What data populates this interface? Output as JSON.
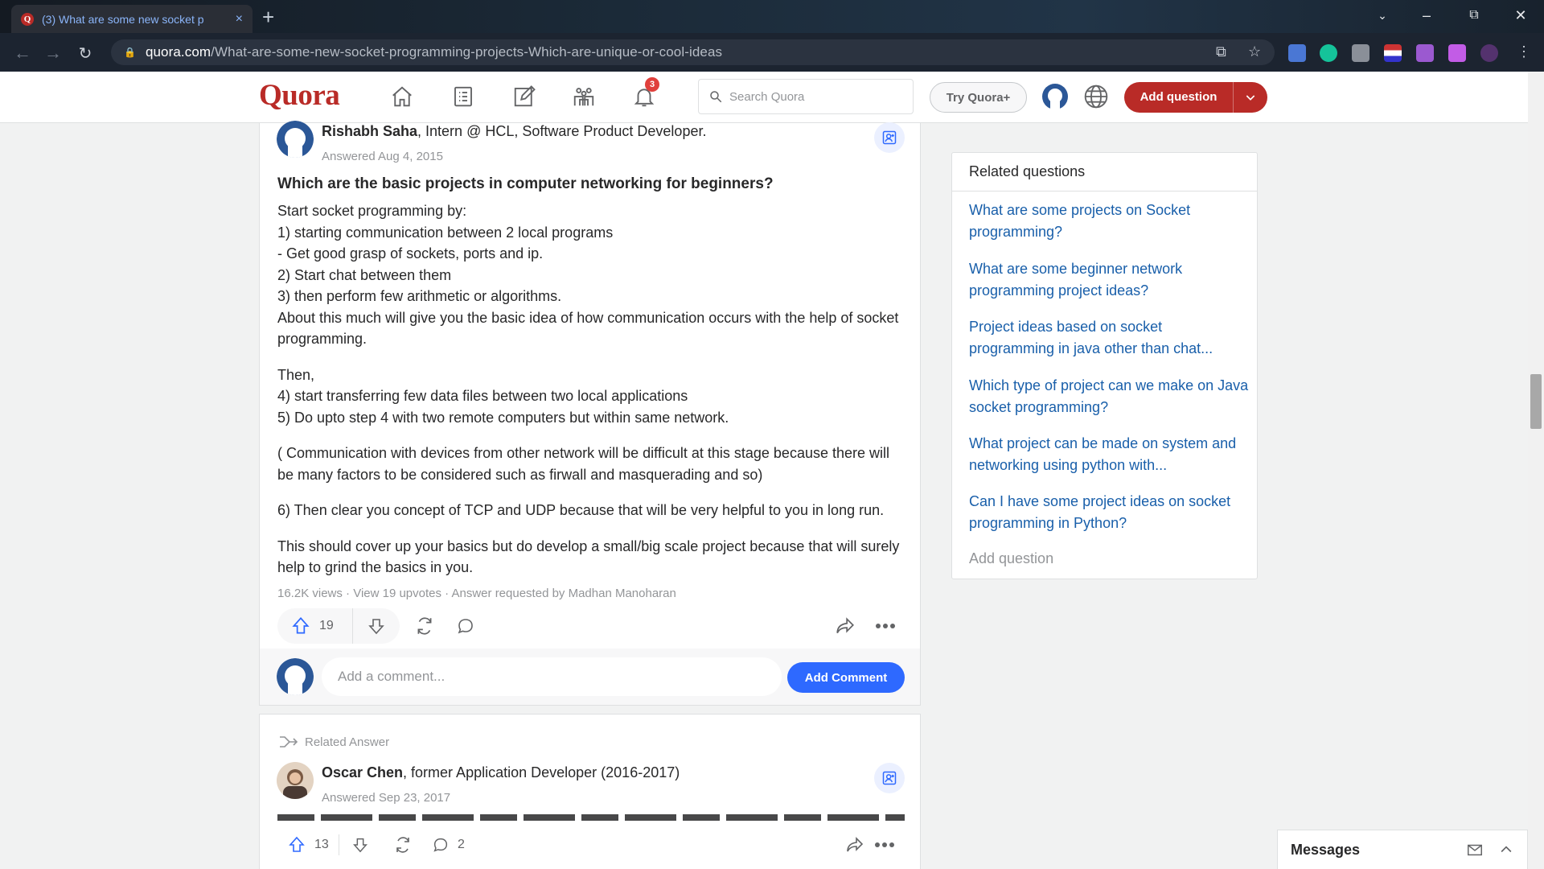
{
  "browser": {
    "tab_title": "(3) What are some new socket p",
    "tab_close": "×",
    "new_tab": "+",
    "url_domain": "quora.com",
    "url_path": "/What-are-some-new-socket-programming-projects-Which-are-unique-or-cool-ideas"
  },
  "header": {
    "logo": "Quora",
    "notification_count": "3",
    "search_placeholder": "Search Quora",
    "try_plus": "Try Quora+",
    "add_question": "Add question"
  },
  "answer": {
    "author_name": "Rishabh Saha",
    "author_cred": ", Intern @ HCL, Software Product Developer.",
    "answered": "Answered Aug 4, 2015",
    "question": "Which are the basic projects in computer networking for beginners?",
    "paragraphs": [
      [
        "Start socket programming by:",
        "1) starting communication between 2 local programs",
        "- Get good grasp of sockets, ports and ip.",
        "2) Start chat between them",
        "3) then perform few arithmetic or algorithms.",
        "About this much will give you the basic idea of how communication occurs with the help of socket programming."
      ],
      [
        "Then,",
        "4) start transferring few data files between two local applications",
        "5) Do upto step 4 with two remote computers but within same network."
      ],
      [
        "( Communication with devices from other network will be difficult at this stage because there will be many factors to be considered such as firwall and masquerading and so)"
      ],
      [
        "6) Then clear you concept of TCP and UDP because that will be very helpful to you in long run."
      ],
      [
        "This should cover up your basics but do develop a small/big scale project because that will surely help to grind the basics in you."
      ]
    ],
    "meta": "16.2K views · View 19 upvotes · Answer requested by Madhan Manoharan",
    "upvotes": "19",
    "comment_placeholder": "Add a comment...",
    "add_comment": "Add Comment"
  },
  "related_answer": {
    "label": "Related Answer",
    "author_name": "Oscar Chen",
    "author_cred": ", former Application Developer (2016-2017)",
    "answered": "Answered Sep 23, 2017",
    "upvotes": "13",
    "comments": "2"
  },
  "related_questions": {
    "title": "Related questions",
    "items": [
      "What are some projects on Socket programming?",
      "What are some beginner network programming project ideas?",
      "Project ideas based on socket programming in java other than chat...",
      "Which type of project can we make on Java socket programming?",
      "What project can be made on system and networking using python with...",
      "Can I have some project ideas on socket programming in Python?"
    ],
    "add_question": "Add question"
  },
  "messages": {
    "title": "Messages"
  },
  "colors": {
    "brand": "#b92b27",
    "link": "#195faa",
    "primary_button": "#2e69ff"
  }
}
